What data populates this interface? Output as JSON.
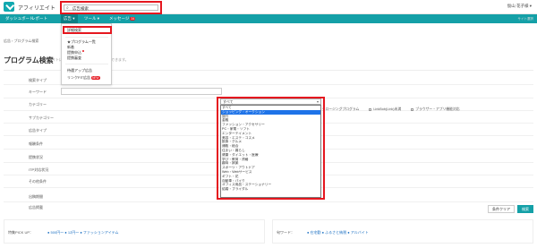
{
  "app": {
    "brand": "アフィリエイト",
    "search_value": "広告検索",
    "user": "仮山 花子様 ▾"
  },
  "nav": {
    "items": [
      {
        "label": "ダッシュボード"
      },
      {
        "label": "レポート"
      },
      {
        "label": "広告 ▾"
      },
      {
        "label": "ツール ▾"
      },
      {
        "label": "メッセージ",
        "badge": "34"
      }
    ],
    "right": "サイト選択"
  },
  "ad_menu": {
    "items": [
      {
        "label": "詳細検索"
      },
      {
        "label": "★プログラム一覧"
      },
      {
        "label": "新着"
      },
      {
        "label": "提携申込"
      },
      {
        "label": "提携審査"
      },
      {
        "label": "待遇アップ広告"
      },
      {
        "label": "リンクFIT広告",
        "badge": "NEW"
      }
    ]
  },
  "breadcrumb": "広告 › プログラム検索",
  "page": {
    "title": "プログラム検索",
    "hint": "サイトに",
    "hint2": "できます。"
  },
  "form": {
    "labels": [
      "検索タイプ",
      "キーワード",
      "カテゴリー",
      "サブカテゴリー",
      "広告タイプ",
      "報酬条件",
      "提携状況",
      "ITP対応状況",
      "その他条件",
      "出稿期間",
      "広告掲載"
    ],
    "radio_text": "◉ で",
    "checkboxes": [
      "新着掲載",
      "終了まで1日未満のプログラム",
      "クロージングプログラム",
      "LinkBob(Link)未満",
      "ブラウザー・アプリ機能対応"
    ]
  },
  "category_select": {
    "value": "すべて",
    "options": [
      "すべて",
      "ショッピング・オークション",
      "旅行",
      "金融",
      "ファッション・アクセサリー",
      "PC・家電・ソフト",
      "エンターテイメント",
      "美容・エステ・コスメ",
      "飲食・グルメ",
      "通販・総合",
      "住まい・暮らし",
      "健康・ダイエット・医療",
      "学び・教育・資格",
      "趣味・娯楽",
      "スポーツ・アウトドア",
      "Web・Webサービス",
      "ギフト・花",
      "自動車・バイク",
      "オフィス用品・ステーショナリー",
      "結婚・ブライダル"
    ],
    "selected_index": 1
  },
  "buttons": {
    "clear": "条件クリア",
    "search": "検索"
  },
  "footer": {
    "left_label": "特集PICK UP：",
    "left_links": "● 500円～ ● 12円～ ● ファッションアイテム",
    "right_label": "旬ワード：",
    "right_links": "● 在宅勤 ● ふるさと納税 ● アルバイト"
  },
  "colors": {
    "accent": "#14a0a7",
    "highlight": "#e5171f",
    "selected": "#1e73e8"
  }
}
